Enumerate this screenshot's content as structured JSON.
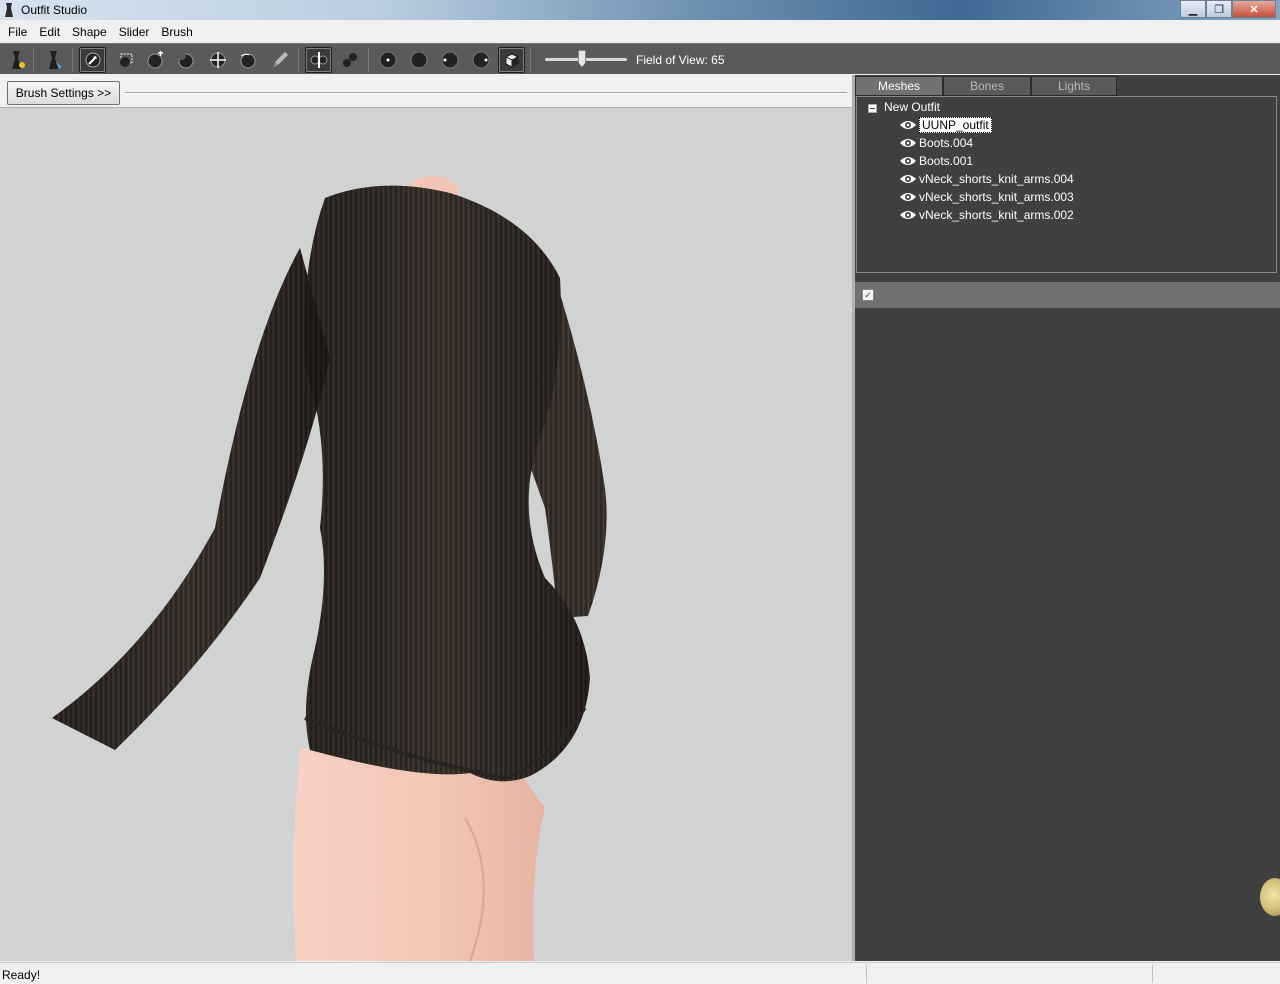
{
  "window": {
    "title": "Outfit Studio"
  },
  "menu": [
    "File",
    "Edit",
    "Shape",
    "Slider",
    "Brush"
  ],
  "toolbar": {
    "fov_label": "Field of View: 65",
    "fov_value": 65,
    "tools": [
      "load-reference-icon",
      "load-outfit-icon",
      "select-brush-icon",
      "mask-icon",
      "inflate-brush-icon",
      "deflate-brush-icon",
      "move-brush-icon",
      "smooth-brush-icon",
      "weight-paint-icon",
      "x-mirror-icon",
      "connected-only-icon",
      "brush-size-small-icon",
      "brush-size-medium-icon",
      "brush-size-large-icon",
      "brush-size-xlarge-icon",
      "flat-shading-icon"
    ]
  },
  "viewport": {
    "brush_settings_label": "Brush Settings >>"
  },
  "tabs": [
    "Meshes",
    "Bones",
    "Lights"
  ],
  "active_tab": "Meshes",
  "tree": {
    "root": "New Outfit",
    "items": [
      {
        "label": "UUNP_outfit",
        "selected": true
      },
      {
        "label": "Boots.004",
        "selected": false
      },
      {
        "label": "Boots.001",
        "selected": false
      },
      {
        "label": "vNeck_shorts_knit_arms.004",
        "selected": false
      },
      {
        "label": "vNeck_shorts_knit_arms.003",
        "selected": false
      },
      {
        "label": "vNeck_shorts_knit_arms.002",
        "selected": false
      }
    ]
  },
  "status": {
    "text": "Ready!"
  },
  "colors": {
    "toolbar_bg": "#5a5a5a",
    "panel_bg": "#404040",
    "viewport_bg": "#d1d2d2",
    "sweater": "#3a312c",
    "skin": "#f4c9bb"
  }
}
